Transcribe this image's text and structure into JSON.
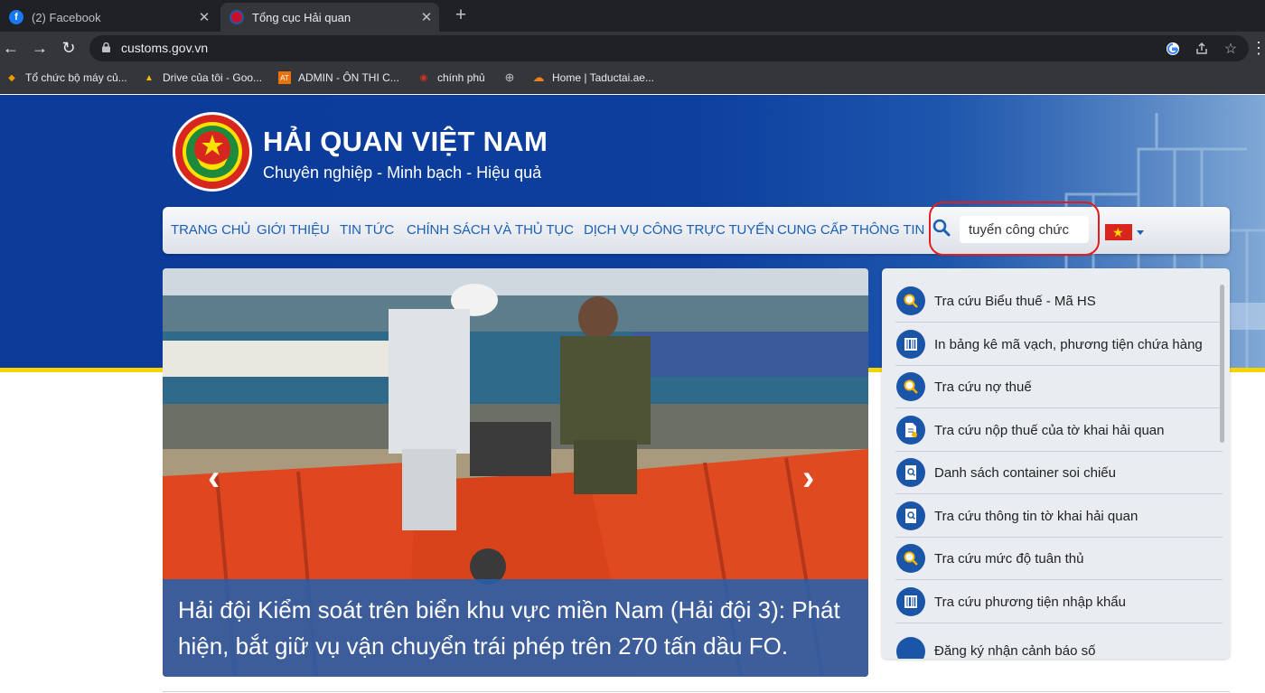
{
  "browser": {
    "tabs": [
      {
        "title": "(2) Facebook",
        "favicon": "facebook-icon"
      },
      {
        "title": "Tổng cục Hải quan",
        "favicon": "customs-emblem-icon"
      }
    ],
    "new_tab": "+",
    "url": "customs.gov.vn",
    "bookmarks": [
      {
        "label": "Tổ chức bộ máy củ...",
        "icon": "bookmark-orange-icon"
      },
      {
        "label": "Drive của tôi - Goo...",
        "icon": "google-drive-icon"
      },
      {
        "label": "ADMIN - ÔN THI C...",
        "icon": "admin-site-icon"
      },
      {
        "label": "chính phủ",
        "icon": "government-icon"
      },
      {
        "label": "",
        "icon": "globe-icon"
      },
      {
        "label": "Home | Taductai.ae...",
        "icon": "cloud-icon"
      }
    ]
  },
  "site": {
    "title": "HẢI QUAN VIỆT NAM",
    "slogan": "Chuyên nghiệp - Minh bạch - Hiệu quả"
  },
  "nav": {
    "items": [
      "TRANG CHỦ",
      "GIỚI THIỆU",
      "TIN TỨC",
      "CHÍNH SÁCH VÀ THỦ TỤC",
      "DỊCH VỤ CÔNG TRỰC TUYẾN",
      "CUNG CẤP THÔNG TIN"
    ],
    "search_value": "tuyển công chức",
    "language": "vietnam-flag"
  },
  "slider": {
    "caption": "Hải đội Kiểm soát trên biển khu vực miền Nam (Hải đội 3): Phát hiện, bắt giữ vụ vận chuyển trái phép trên 270 tấn dầu FO.",
    "prev": "‹",
    "next": "›"
  },
  "services": {
    "items": [
      {
        "label": "Tra cứu Biểu thuế - Mã HS",
        "icon": "search-icon"
      },
      {
        "label": "In bảng kê mã vạch, phương tiện chứa hàng",
        "icon": "barcode-icon"
      },
      {
        "label": "Tra cứu nợ thuế",
        "icon": "search-icon"
      },
      {
        "label": "Tra cứu nộp thuế của tờ khai hải quan",
        "icon": "document-icon"
      },
      {
        "label": "Danh sách container soi chiếu",
        "icon": "document-search-icon"
      },
      {
        "label": "Tra cứu thông tin tờ khai hải quan",
        "icon": "document-search-icon"
      },
      {
        "label": "Tra cứu mức độ tuân thủ",
        "icon": "search-icon"
      },
      {
        "label": "Tra cứu phương tiện nhập khẩu",
        "icon": "barcode-icon"
      },
      {
        "label": "Đăng ký nhận cảnh báo số",
        "icon": "document-icon"
      }
    ]
  },
  "colors": {
    "header_blue": "#0d3f9f",
    "nav_link": "#1b60b6",
    "highlight_circle": "#e31d1d",
    "yellow_stripe": "#f7d400"
  }
}
